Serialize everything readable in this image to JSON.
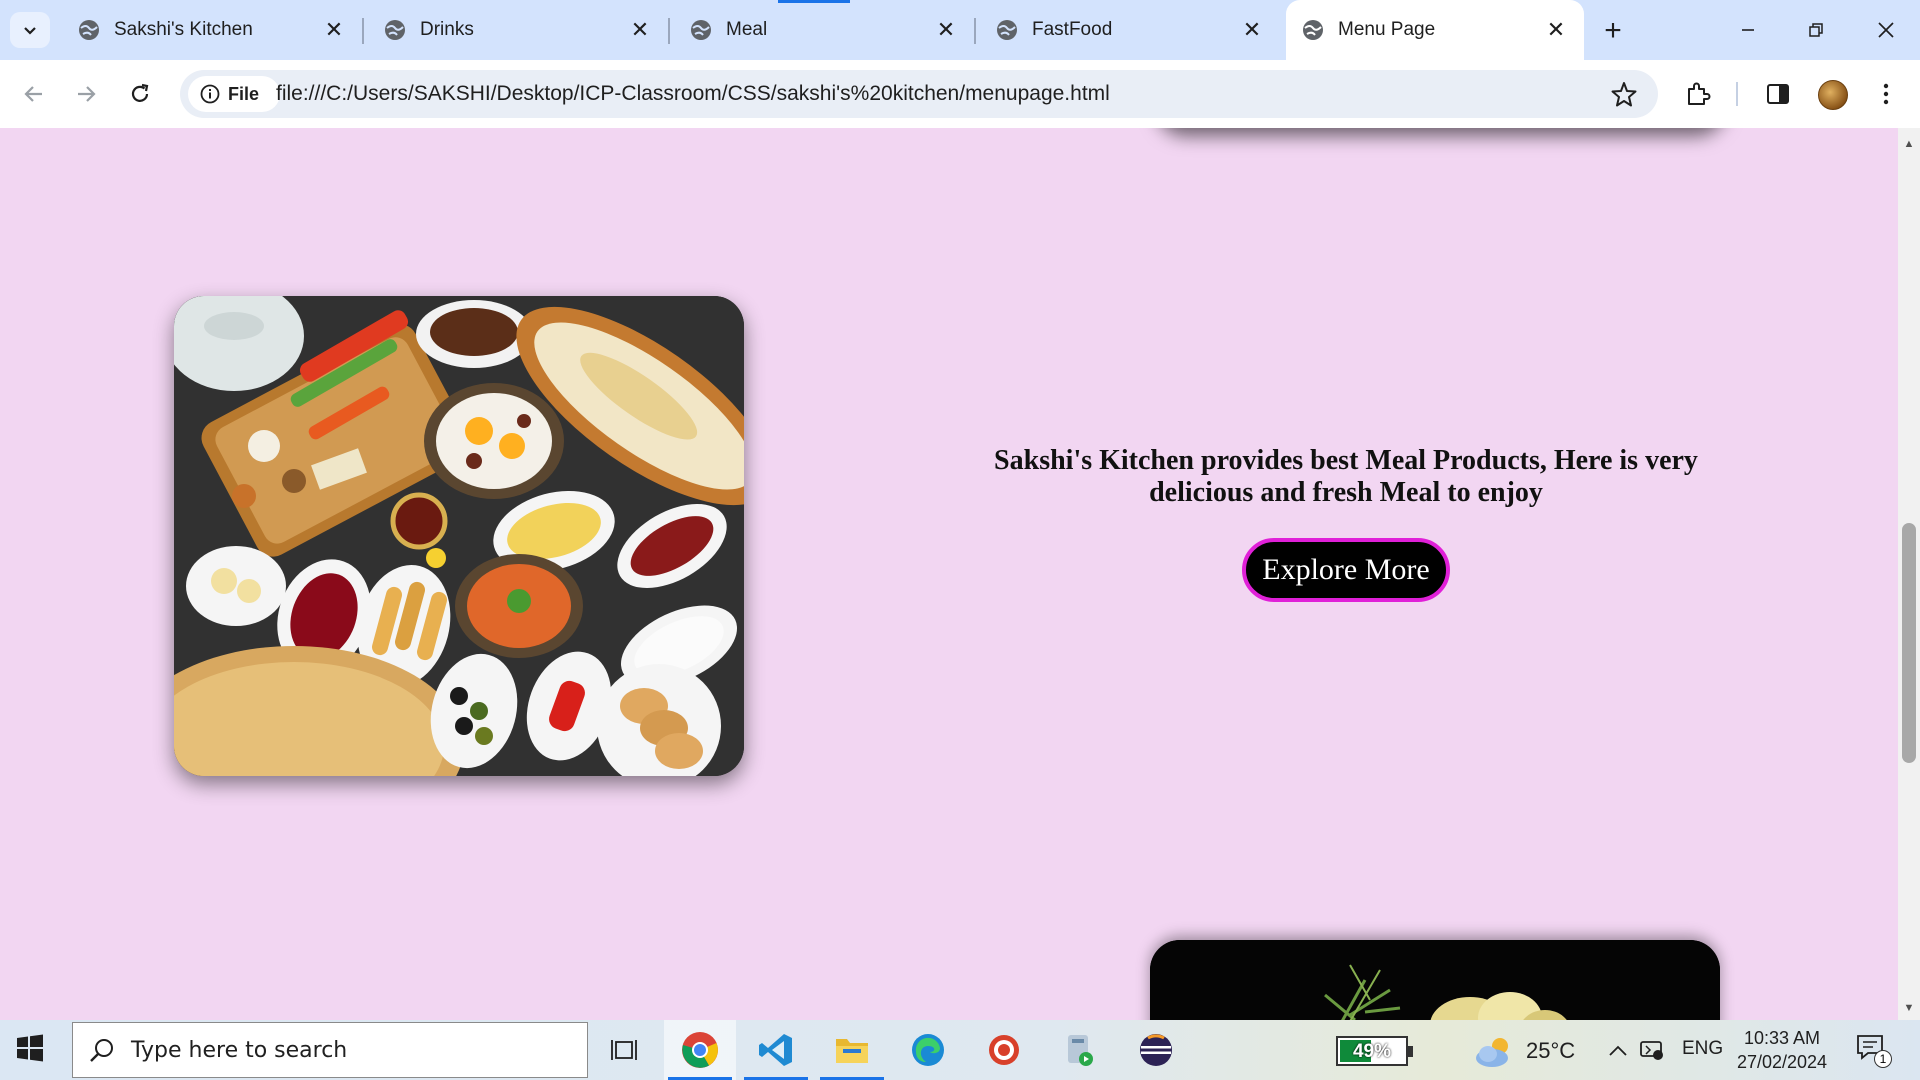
{
  "browser": {
    "tabs": [
      {
        "title": "Sakshi's Kitchen",
        "active": false
      },
      {
        "title": "Drinks",
        "active": false
      },
      {
        "title": "Meal",
        "active": false
      },
      {
        "title": "FastFood",
        "active": false
      },
      {
        "title": "Menu Page",
        "active": true
      }
    ],
    "new_tab_label": "+",
    "close_glyph": "✕",
    "site_chip_label": "File",
    "url": "file:///C:/Users/SAKSHI/Desktop/ICP-Classroom/CSS/sakshi's%20kitchen/menupage.html",
    "icons": [
      "tab-search-icon",
      "back-icon",
      "forward-icon",
      "reload-icon",
      "info-icon",
      "star-icon",
      "extensions-icon",
      "side-panel-icon",
      "profile-avatar",
      "menu-icon",
      "minimize-icon",
      "restore-icon",
      "close-window-icon"
    ]
  },
  "page": {
    "meal_section": {
      "description": "Sakshi's Kitchen provides best Meal Products, Here is very delicious and fresh Meal to enjoy",
      "button_label": "Explore More"
    },
    "colors": {
      "page_background": "#f2d6f2",
      "button_background": "#000000",
      "button_border": "#e020d8"
    }
  },
  "taskbar": {
    "search_placeholder": "Type here to search",
    "apps": [
      "task-view",
      "chrome",
      "vs-code",
      "file-explorer",
      "edge",
      "target-app",
      "installer-app",
      "eclipse"
    ],
    "battery_percent": "49%",
    "battery_level": 0.49,
    "temperature": "25°C",
    "language": "ENG",
    "time": "10:33 AM",
    "date": "27/02/2024",
    "notification_count": "1"
  }
}
